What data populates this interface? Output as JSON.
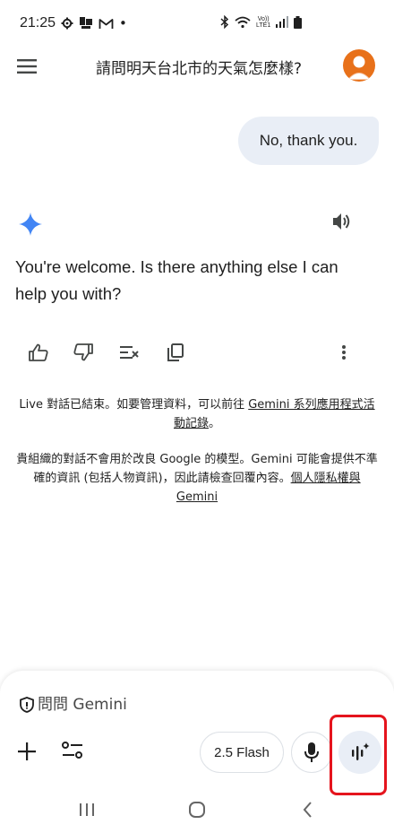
{
  "status_bar": {
    "time": "21:25",
    "dot": "•",
    "left_icons": [
      "settings-gear-icon",
      "app-notification-icon",
      "gmail-icon"
    ],
    "right_icons": [
      "bluetooth-icon",
      "wifi-icon",
      "volte-icon",
      "signal-icon",
      "battery-icon"
    ],
    "volte_top": "Vo))",
    "volte_bottom": "LTE1"
  },
  "header": {
    "title": "請問明天台北市的天氣怎麼樣?",
    "menu_icon": "menu-icon",
    "avatar_color": "#e8711a"
  },
  "conversation": {
    "user_message": "No, thank you.",
    "response_text": "You're welcome. Is there anything else I can help you with?",
    "gemini_star_color": "#4285f4"
  },
  "actions": {
    "items": [
      "thumbs-up-icon",
      "thumbs-down-icon",
      "modify-response-icon",
      "copy-icon",
      "more-vert-icon"
    ]
  },
  "notices": {
    "live_prefix": "Live 對話已結束。如要管理資料，可以前往 ",
    "live_link": "Gemini 系列應用程式活動記錄",
    "live_suffix": "。",
    "privacy_prefix": "貴組織的對話不會用於改良 Google 的模型。Gemini 可能會提供不準確的資訊 (包括人物資訊)，因此請檢查回覆內容。",
    "privacy_link": "個人隱私權與 Gemini"
  },
  "input": {
    "placeholder": "問問 Gemini",
    "model_label": "2.5 Flash",
    "live_bg": "#e9eef6",
    "highlight_color": "#e5141d"
  },
  "nav": {
    "items": [
      "recent-apps-icon",
      "home-icon",
      "back-icon"
    ]
  }
}
